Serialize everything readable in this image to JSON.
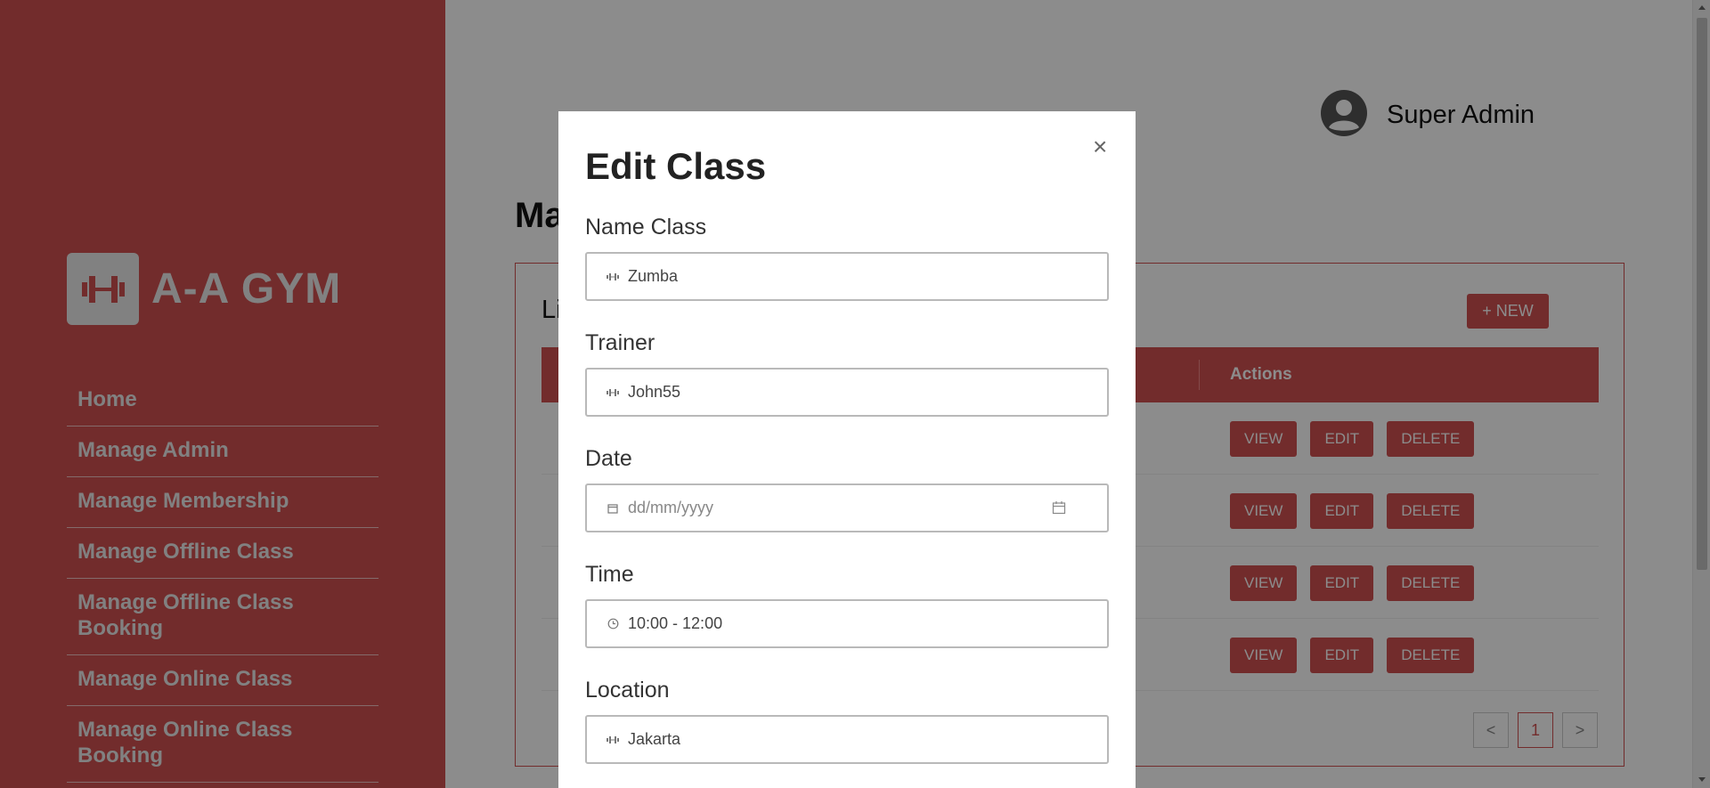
{
  "brand": {
    "name": "A-A GYM",
    "icon": "dumbbell-icon"
  },
  "sidebar": {
    "items": [
      {
        "label": "Home"
      },
      {
        "label": "Manage Admin"
      },
      {
        "label": "Manage Membership"
      },
      {
        "label": "Manage Offline Class"
      },
      {
        "label": "Manage Offline Class Booking"
      },
      {
        "label": "Manage Online Class"
      },
      {
        "label": "Manage Online Class Booking"
      }
    ]
  },
  "header": {
    "user_name": "Super Admin",
    "user_icon": "user-circle-icon"
  },
  "page": {
    "title": "Ma",
    "card_title": "Li",
    "new_button": "+ NEW"
  },
  "table": {
    "actions_header": "Actions",
    "row_actions": {
      "view": "VIEW",
      "edit": "EDIT",
      "delete": "DELETE"
    },
    "rows": 4
  },
  "pagination": {
    "prev": "<",
    "current": "1",
    "next": ">"
  },
  "modal": {
    "title": "Edit Class",
    "close": "×",
    "fields": {
      "name_class": {
        "label": "Name Class",
        "value": "Zumba",
        "icon": "dumbbell-icon"
      },
      "trainer": {
        "label": "Trainer",
        "value": "John55",
        "icon": "dumbbell-icon"
      },
      "date": {
        "label": "Date",
        "placeholder": "dd/mm/yyyy",
        "icon": "calendar-icon"
      },
      "time": {
        "label": "Time",
        "value": "10:00 - 12:00",
        "icon": "clock-icon"
      },
      "location": {
        "label": "Location",
        "value": "Jakarta",
        "icon": "dumbbell-icon"
      }
    }
  },
  "colors": {
    "accent": "#d05050",
    "sidebar_text": "#ebebeb"
  }
}
